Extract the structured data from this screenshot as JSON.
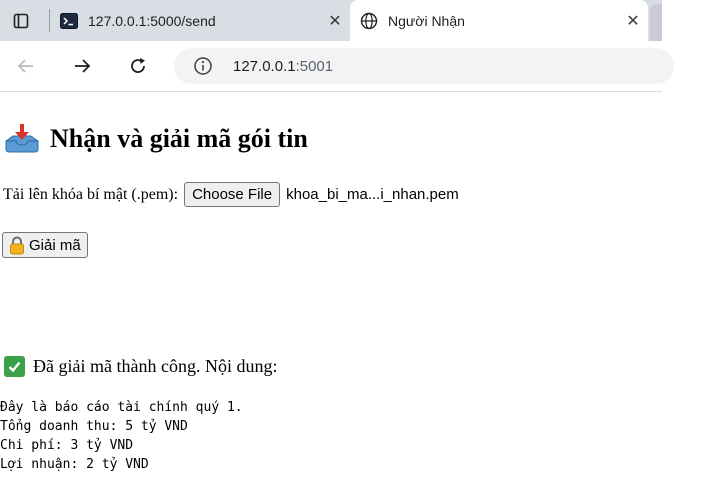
{
  "browser": {
    "tabs": [
      {
        "title": "127.0.0.1:5000/send",
        "icon": "terminal-icon",
        "active": false
      },
      {
        "title": "Người Nhận",
        "icon": "globe-icon",
        "active": true
      }
    ],
    "close_glyph": "✕",
    "address": {
      "host": "127.0.0.1",
      "port": ":5001"
    }
  },
  "page": {
    "heading": "Nhận và giải mã gói tin",
    "upload": {
      "label": "Tải lên khóa bí mật (.pem):",
      "button": "Choose File",
      "file_name": "khoa_bi_ma...i_nhan.pem"
    },
    "decrypt_button": "Giải mã",
    "success_message": "Đã giải mã thành công. Nội dung:",
    "output_lines": [
      "Đây là báo cáo tài chính quý 1.",
      "Tổng doanh thu: 5 tỷ VND",
      "Chi phí: 3 tỷ VND",
      "Lợi nhuận: 2 tỷ VND"
    ]
  },
  "colors": {
    "tabstrip": "#d9dde4",
    "omnibox": "#f1f3f4",
    "success_check": "#3aa14a"
  }
}
